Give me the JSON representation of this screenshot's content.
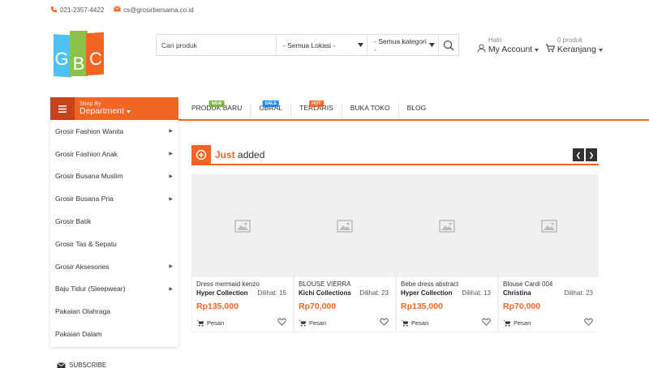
{
  "topbar": {
    "phone": "021-2357-4422",
    "email": "cs@grosirbersama.co.id"
  },
  "brand": {
    "letters": [
      "G",
      "B",
      "C"
    ]
  },
  "search": {
    "placeholder": "Cari produk",
    "location": "- Semua Lokasi -",
    "category": "- Semua kategori -"
  },
  "account": {
    "greeting": "Halo",
    "label": "My Account"
  },
  "cart": {
    "count_label": "0 produk",
    "label": "Keranjang"
  },
  "department": {
    "small": "Shop By",
    "big": "Department"
  },
  "nav": [
    {
      "label": "PRODUK BARU",
      "badge": "NEW",
      "badge_type": "new"
    },
    {
      "label": "OBRAL",
      "badge": "SALE",
      "badge_type": "sale"
    },
    {
      "label": "TERLARIS",
      "badge": "HOT",
      "badge_type": "hot"
    },
    {
      "label": "BUKA TOKO",
      "badge": "",
      "badge_type": ""
    },
    {
      "label": "BLOG",
      "badge": "",
      "badge_type": ""
    }
  ],
  "sidebar": [
    {
      "label": "Grosir Fashion Wanita",
      "sub": true
    },
    {
      "label": "Grosir Fashion Anak",
      "sub": true
    },
    {
      "label": "Grosir Busana Muslim",
      "sub": true
    },
    {
      "label": "Grosir Busana Pria",
      "sub": true
    },
    {
      "label": "Grosir Batik",
      "sub": false
    },
    {
      "label": "Grosir Tas & Sepatu",
      "sub": false
    },
    {
      "label": "Grosir Aksesories",
      "sub": true
    },
    {
      "label": "Baju Tidur (Sleepwear)",
      "sub": true
    },
    {
      "label": "Pakaian Olahraga",
      "sub": false
    },
    {
      "label": "Pakaian Dalam",
      "sub": false
    }
  ],
  "subscribe": "SUBSCRIBE",
  "section": {
    "title_highlight": "Just",
    "title_rest": " added"
  },
  "products": [
    {
      "name": "Dress mermaid kenzo",
      "shop": "Hyper Collection",
      "views": "Dilihat: 16",
      "price": "Rp135,000",
      "action": "Pesan"
    },
    {
      "name": "BLOUSE VIERRA",
      "shop": "Kichi Collections",
      "views": "Dilihat: 23",
      "price": "Rp70,000",
      "action": "Pesan"
    },
    {
      "name": "Bebe dress abstract",
      "shop": "Hyper Collection",
      "views": "Dilihat: 13",
      "price": "Rp135,000",
      "action": "Pesan"
    },
    {
      "name": "Blouse Cardi 004",
      "shop": "Christina",
      "views": "Dilihat: 23",
      "price": "Rp70,000",
      "action": "Pesan"
    }
  ],
  "colors": {
    "accent": "#f26522",
    "accent_dark": "#c7441b"
  }
}
